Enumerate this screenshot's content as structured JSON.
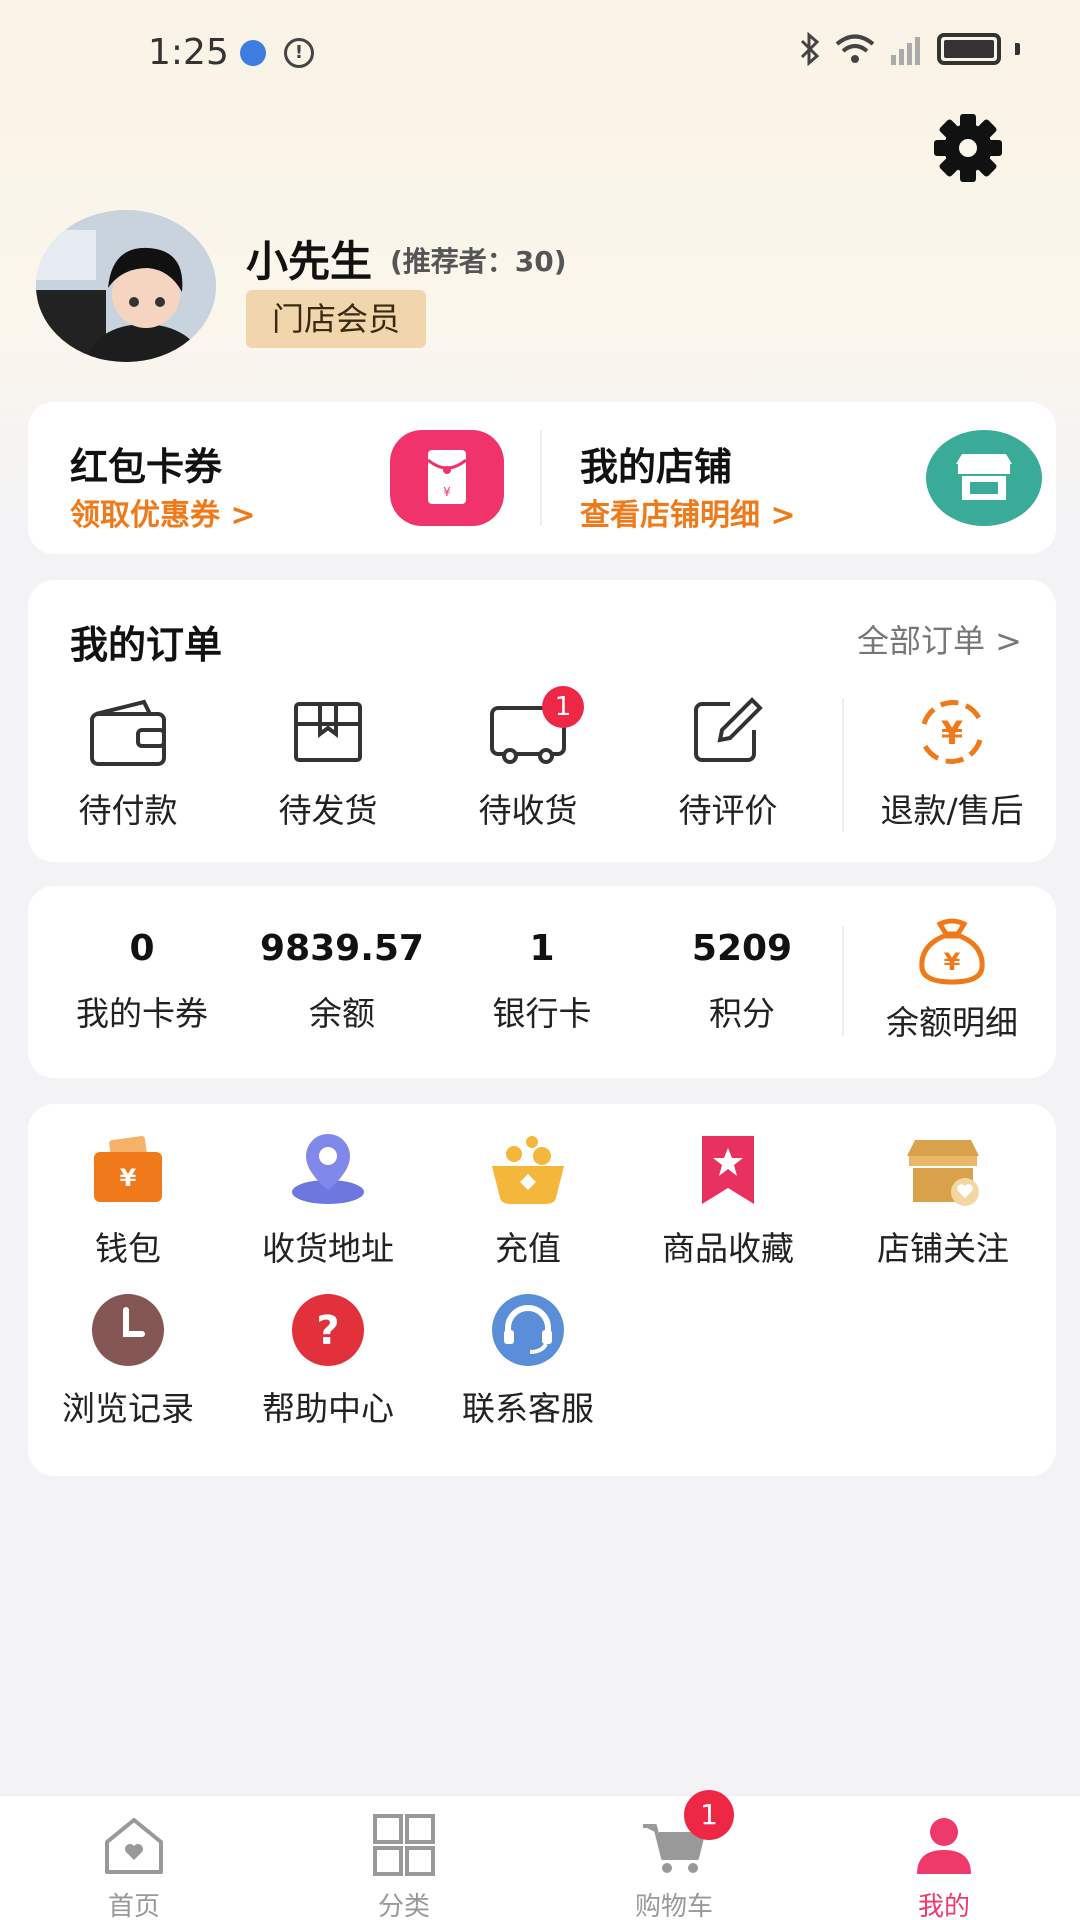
{
  "status_bar": {
    "time": "1:25"
  },
  "profile": {
    "name": "小先生",
    "referrer": "(推荐者：30)",
    "member_tag": "门店会员"
  },
  "promo": {
    "coupons": {
      "title": "红包卡券",
      "subtitle": "领取优惠券 >"
    },
    "store": {
      "title": "我的店铺",
      "subtitle": "查看店铺明细 >"
    }
  },
  "orders": {
    "title": "我的订单",
    "all_link": "全部订单 >",
    "items": [
      {
        "label": "待付款",
        "icon": "wallet-icon"
      },
      {
        "label": "待发货",
        "icon": "box-icon"
      },
      {
        "label": "待收货",
        "icon": "truck-icon",
        "badge": "1"
      },
      {
        "label": "待评价",
        "icon": "edit-icon"
      },
      {
        "label": "退款/售后",
        "icon": "refund-icon"
      }
    ]
  },
  "assets": {
    "items": [
      {
        "value": "0",
        "label": "我的卡券"
      },
      {
        "value": "9839.57",
        "label": "余额"
      },
      {
        "value": "1",
        "label": "银行卡"
      },
      {
        "value": "5209",
        "label": "积分"
      }
    ],
    "detail_label": "余额明细"
  },
  "tools": {
    "items": [
      {
        "label": "钱包",
        "icon": "wallet-yen-icon"
      },
      {
        "label": "收货地址",
        "icon": "location-pin-icon"
      },
      {
        "label": "充值",
        "icon": "recharge-icon"
      },
      {
        "label": "商品收藏",
        "icon": "bookmark-star-icon"
      },
      {
        "label": "店铺关注",
        "icon": "store-heart-icon"
      },
      {
        "label": "浏览记录",
        "icon": "clock-icon"
      },
      {
        "label": "帮助中心",
        "icon": "question-icon"
      },
      {
        "label": "联系客服",
        "icon": "headset-icon"
      }
    ]
  },
  "tab_bar": {
    "items": [
      {
        "label": "首页",
        "icon": "home-icon"
      },
      {
        "label": "分类",
        "icon": "category-grid-icon"
      },
      {
        "label": "购物车",
        "icon": "cart-icon",
        "badge": "1"
      },
      {
        "label": "我的",
        "icon": "user-icon",
        "active": true
      }
    ]
  },
  "colors": {
    "accent_orange": "#f07a1a",
    "accent_pink": "#ee3a6a",
    "badge_red": "#ee2744"
  }
}
